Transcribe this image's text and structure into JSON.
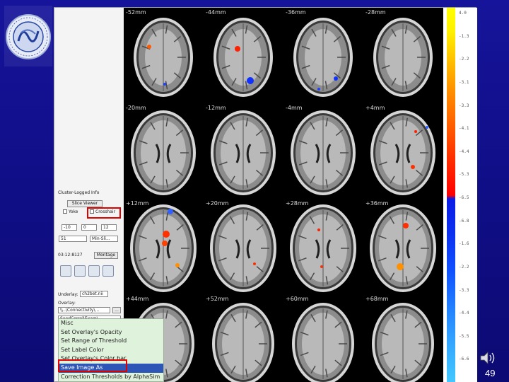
{
  "slices": [
    {
      "label": "-52mm"
    },
    {
      "label": "-44mm"
    },
    {
      "label": "-36mm"
    },
    {
      "label": "-28mm"
    },
    {
      "label": "-20mm"
    },
    {
      "label": "-12mm"
    },
    {
      "label": "-4mm"
    },
    {
      "label": "+4mm"
    },
    {
      "label": "+12mm"
    },
    {
      "label": "+20mm"
    },
    {
      "label": "+28mm"
    },
    {
      "label": "+36mm"
    },
    {
      "label": "+44mm"
    },
    {
      "label": "+52mm"
    },
    {
      "label": "+60mm"
    },
    {
      "label": "+68mm"
    }
  ],
  "colorbar": {
    "ticks": [
      "4.0",
      "-1.3",
      "-2.2",
      "-3.1",
      "-3.3",
      "-4.1",
      "-4.4",
      "-5.3",
      "-6.5",
      "-6.8",
      "-1.6",
      "-2.2",
      "-3.3",
      "-4.4",
      "-5.5",
      "-6.6"
    ]
  },
  "panel": {
    "cluster_label": "Cluster-Logged Info",
    "slice_viewer_button": "Slice Viewer",
    "yoke_label": "Yoke",
    "crosshair_label": "Crosshair",
    "field_values": [
      "-10",
      "0",
      "12"
    ],
    "dropdown_1": "51",
    "dropdown_2": "Min-Sli...",
    "coords_label": "03:12:8127",
    "montage_button": "Montage",
    "underlay_label": "Underlay:",
    "underlay_path": "ch2bet.nii",
    "overlay_label": "Overlay:",
    "overlay_path": "\\\\..\\Connectivity\\...",
    "overlay_path2": "SeedCorrel\\Exam\\...",
    "browse_button": "..."
  },
  "menu": {
    "items": [
      {
        "label": "Misc"
      },
      {
        "label": "Set Overlay's Opacity"
      },
      {
        "label": "Set Range of Threshold"
      },
      {
        "label": "Set Label Color"
      },
      {
        "label": "Set Overlay's Color bar"
      },
      {
        "label": "Save Image As",
        "selected": true
      },
      {
        "label": "Correction Thresholds by AlphaSim"
      }
    ]
  },
  "logo_text": "首都医科大学宣武医院",
  "page_number": "49",
  "colors": {
    "background": "#14128f",
    "highlight_box": "#e00000",
    "menu_selected": "#2d56b7",
    "menu_bg": "#dff2dc"
  }
}
